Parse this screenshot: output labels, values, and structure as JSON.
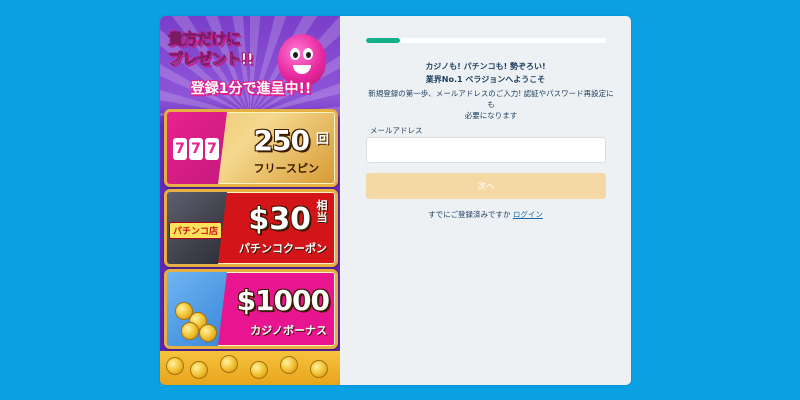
{
  "banner": {
    "headline_line1": "貴方だけに",
    "headline_line2": "プレゼント!!",
    "headline_line3": "登録1分で進呈中!!",
    "mascot_icon": "pink-mascot-icon",
    "offers": [
      {
        "big": "250",
        "unit": "回",
        "sub": "フリースピン",
        "slot_reels": [
          "7",
          "7",
          "7"
        ]
      },
      {
        "big": "$30",
        "unit": "相当",
        "sub": "パチンコクーポン",
        "tag": "パチンコ店"
      },
      {
        "big": "$1000",
        "sub": "カジノボーナス"
      }
    ],
    "colors": {
      "purple": "#7a3fc9",
      "gold": "#e6b043",
      "red": "#d31418",
      "pink": "#e9148f"
    }
  },
  "signup": {
    "progress": 0.14,
    "welcome_line1": "カジノも! パチンコも! 勢ぞろい!",
    "welcome_line2": "業界No.1 ベラジョンへようこそ",
    "info_line1": "新規登録の第一歩、メールアドレスのご入力! 認証やパスワード再設定にも",
    "info_line2": "必要になります",
    "email_label": "メールアドレス",
    "email_value": "",
    "next_label": "次へ",
    "login_prompt": "すでにご登録済みですか",
    "login_link": "ログイン"
  },
  "colors": {
    "page_bg": "#0aa0e2",
    "panel_bg": "#eef1f4",
    "accent_green": "#14b08a",
    "button_disabled": "#f5d9a4",
    "link": "#1a6aa8",
    "text": "#1a3d5e"
  }
}
